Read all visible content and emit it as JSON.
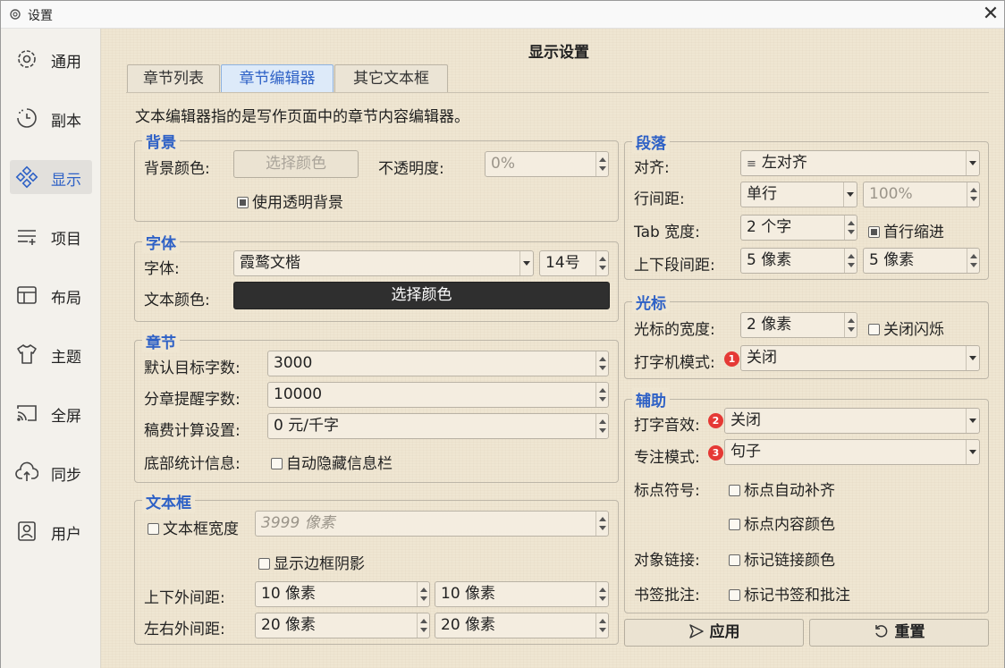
{
  "window": {
    "title": "设置",
    "close_glyph": "✕"
  },
  "sidebar": {
    "items": [
      {
        "label": "通用",
        "icon": "gear-icon"
      },
      {
        "label": "副本",
        "icon": "history-icon"
      },
      {
        "label": "显示",
        "icon": "display-icon"
      },
      {
        "label": "项目",
        "icon": "list-add-icon"
      },
      {
        "label": "布局",
        "icon": "layout-icon"
      },
      {
        "label": "主题",
        "icon": "shirt-icon"
      },
      {
        "label": "全屏",
        "icon": "cast-icon"
      },
      {
        "label": "同步",
        "icon": "cloud-upload-icon"
      },
      {
        "label": "用户",
        "icon": "user-icon"
      }
    ],
    "active": "显示"
  },
  "page": {
    "title": "显示设置",
    "description": "文本编辑器指的是写作页面中的章节内容编辑器。"
  },
  "tabs": [
    {
      "label": "章节列表"
    },
    {
      "label": "章节编辑器"
    },
    {
      "label": "其它文本框"
    }
  ],
  "background": {
    "title": "背景",
    "color_label": "背景颜色:",
    "color_button": "选择颜色",
    "opacity_label": "不透明度:",
    "opacity_value": "0%",
    "transparent_label": "使用透明背景"
  },
  "font": {
    "title": "字体",
    "font_label": "字体:",
    "font_value": "霞鹜文楷",
    "size_value": "14号",
    "color_label": "文本颜色:",
    "color_button": "选择颜色"
  },
  "chapter": {
    "title": "章节",
    "target_label": "默认目标字数:",
    "target_value": "3000",
    "remind_label": "分章提醒字数:",
    "remind_value": "10000",
    "fee_label": "稿费计算设置:",
    "fee_value": "0 元/千字",
    "stats_label": "底部统计信息:",
    "autohide_label": "自动隐藏信息栏"
  },
  "textbox": {
    "title": "文本框",
    "width_label": "文本框宽度",
    "width_value": "3999 像素",
    "shadow_label": "显示边框阴影",
    "vmargin_label": "上下外间距:",
    "vmargin_value1": "10 像素",
    "vmargin_value2": "10 像素",
    "hmargin_label": "左右外间距:",
    "hmargin_value1": "20 像素",
    "hmargin_value2": "20 像素"
  },
  "paragraph": {
    "title": "段落",
    "align_label": "对齐:",
    "align_value": "左对齐",
    "align_glyph": "≡",
    "spacing_label": "行间距:",
    "spacing_value": "单行",
    "spacing_percent": "100%",
    "tab_label": "Tab 宽度:",
    "tab_value": "2 个字",
    "indent_label": "首行缩进",
    "para_spacing_label": "上下段间距:",
    "para_spacing_value1": "5 像素",
    "para_spacing_value2": "5 像素"
  },
  "cursor": {
    "title": "光标",
    "width_label": "光标的宽度:",
    "width_value": "2 像素",
    "blink_label": "关闭闪烁",
    "typewriter_label": "打字机模式:",
    "typewriter_badge": "1",
    "typewriter_value": "关闭"
  },
  "assist": {
    "title": "辅助",
    "sound_label": "打字音效:",
    "sound_badge": "2",
    "sound_value": "关闭",
    "focus_label": "专注模式:",
    "focus_badge": "3",
    "focus_value": "句子",
    "punct_label": "标点符号:",
    "punct_auto_label": "标点自动补齐",
    "punct_color_label": "标点内容颜色",
    "link_label": "对象链接:",
    "link_color_label": "标记链接颜色",
    "bookmark_label": "书签批注:",
    "bookmark_mark_label": "标记书签和批注"
  },
  "actions": {
    "apply_label": "应用",
    "reset_label": "重置"
  },
  "colors": {
    "accent": "#2e61c6",
    "badge": "#e53935",
    "content_bg": "#efe6d2"
  }
}
